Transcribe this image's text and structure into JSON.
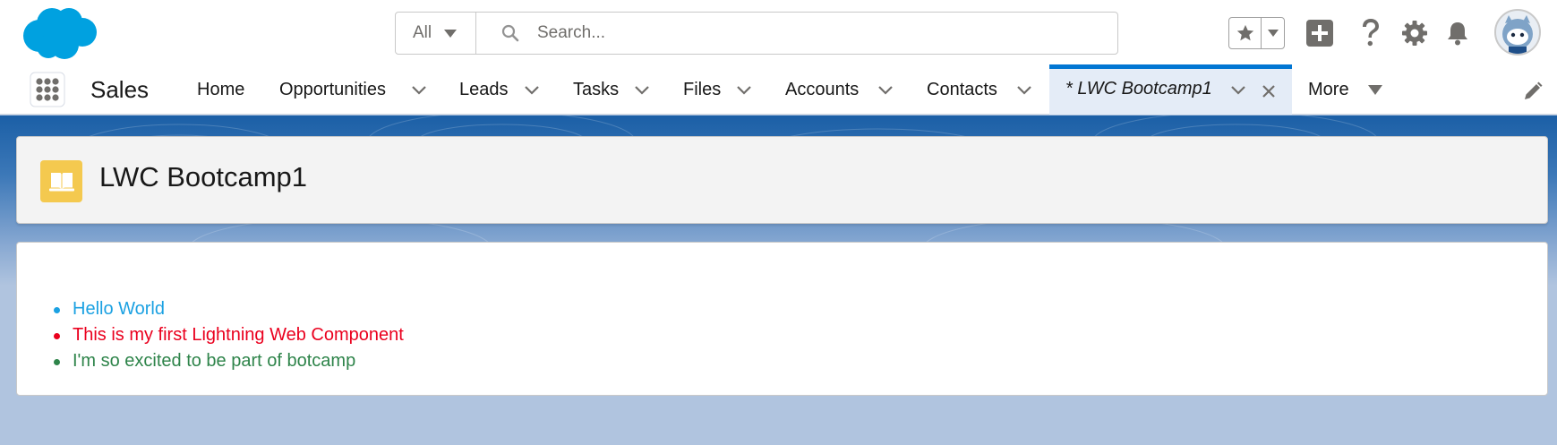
{
  "header": {
    "logo_icon": "salesforce-cloud-logo",
    "search": {
      "scope_label": "All",
      "placeholder": "Search..."
    },
    "icons": [
      "favorites-star-icon",
      "global-actions-plus-icon",
      "help-question-icon",
      "setup-gear-icon",
      "notifications-bell-icon",
      "user-avatar"
    ]
  },
  "nav": {
    "app_name": "Sales",
    "items": [
      {
        "label": "Home",
        "has_menu": false
      },
      {
        "label": "Opportunities",
        "has_menu": true
      },
      {
        "label": "Leads",
        "has_menu": true
      },
      {
        "label": "Tasks",
        "has_menu": true
      },
      {
        "label": "Files",
        "has_menu": true
      },
      {
        "label": "Accounts",
        "has_menu": true
      },
      {
        "label": "Contacts",
        "has_menu": true
      }
    ],
    "active_tab": {
      "label": "* LWC Bootcamp1"
    },
    "more_label": "More"
  },
  "page": {
    "title": "LWC Bootcamp1",
    "icon": "book-icon",
    "icon_color": "#f4c94f"
  },
  "content": {
    "messages": [
      {
        "text": "Hello World",
        "color": "#1ba1e2"
      },
      {
        "text": "This is my first Lightning Web Component",
        "color": "#ea001e"
      },
      {
        "text": "I'm so excited to be part of botcamp",
        "color": "#2e844a"
      }
    ]
  },
  "colors": {
    "brand_blue": "#0176d3",
    "active_tab_bg": "#e4ecf7"
  }
}
